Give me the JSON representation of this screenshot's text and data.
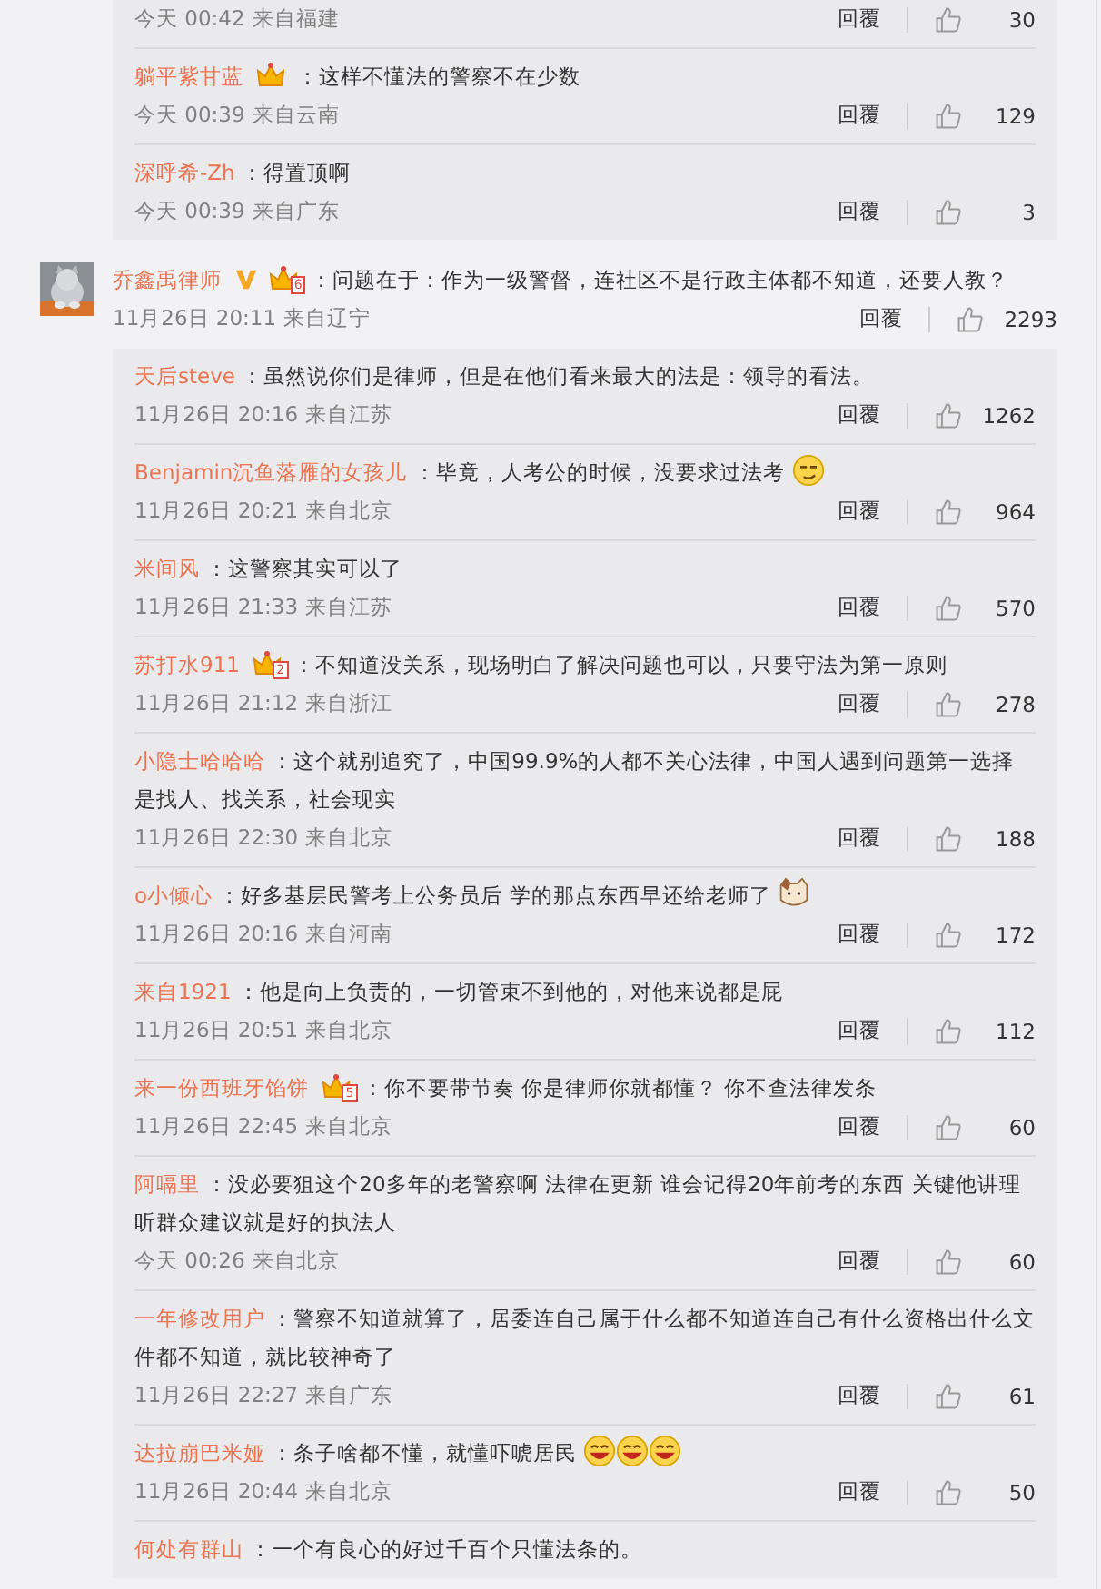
{
  "blocks": [
    {
      "kind": "replies",
      "replies": [
        {
          "time": "今天 00:42",
          "location": "来自福建",
          "reply_label": "回覆",
          "likes": "30"
        },
        {
          "user": "躺平紫甘蓝",
          "badge": {
            "kind": "crown"
          },
          "text": "：这样不懂法的警察不在少数",
          "time": "今天 00:39",
          "location": "来自云南",
          "reply_label": "回覆",
          "likes": "129"
        },
        {
          "user": "深呼希-Zh",
          "text": "：得置顶啊",
          "time": "今天 00:39",
          "location": "来自广东",
          "reply_label": "回覆",
          "likes": "3"
        }
      ]
    },
    {
      "kind": "comment",
      "user": "乔鑫禹律师",
      "verified": true,
      "badge": {
        "kind": "crown",
        "level": "6"
      },
      "text": "：问题在于：作为一级警督，连社区不是行政主体都不知道，还要人教？",
      "time": "11月26日 20:11",
      "location": "来自辽宁",
      "reply_label": "回覆",
      "likes": "2293"
    },
    {
      "kind": "replies",
      "replies": [
        {
          "user": "天后steve",
          "text": "：虽然说你们是律师，但是在他们看来最大的法是：领导的看法。",
          "time": "11月26日 20:16",
          "location": "来自江苏",
          "reply_label": "回覆",
          "likes": "1262"
        },
        {
          "user": "Benjamin沉鱼落雁的女孩儿",
          "text": "：毕竟，人考公的时候，没要求过法考",
          "emojis": [
            {
              "kind": "smirk"
            }
          ],
          "time": "11月26日 20:21",
          "location": "来自北京",
          "reply_label": "回覆",
          "likes": "964"
        },
        {
          "user": "米间风",
          "text": "：这警察其实可以了",
          "time": "11月26日 21:33",
          "location": "来自江苏",
          "reply_label": "回覆",
          "likes": "570"
        },
        {
          "user": "苏打水911",
          "badge": {
            "kind": "crown",
            "level": "2"
          },
          "text": "：不知道没关系，现场明白了解决问题也可以，只要守法为第一原则",
          "time": "11月26日 21:12",
          "location": "来自浙江",
          "reply_label": "回覆",
          "likes": "278"
        },
        {
          "user": "小隐士哈哈哈",
          "text": "：这个就别追究了，中国99.9%的人都不关心法律，中国人遇到问题第一选择是找人、找关系，社会现实",
          "time": "11月26日 22:30",
          "location": "来自北京",
          "reply_label": "回覆",
          "likes": "188"
        },
        {
          "user": "o小倾心",
          "text": "：好多基层民警考上公务员后 学的那点东西早还给老师了",
          "emojis": [
            {
              "kind": "cat"
            }
          ],
          "time": "11月26日 20:16",
          "location": "来自河南",
          "reply_label": "回覆",
          "likes": "172"
        },
        {
          "user": "来自1921",
          "text": "：他是向上负责的，一切管束不到他的，对他来说都是屁",
          "time": "11月26日 20:51",
          "location": "来自北京",
          "reply_label": "回覆",
          "likes": "112"
        },
        {
          "user": "来一份西班牙馅饼",
          "badge": {
            "kind": "crown",
            "level": "5"
          },
          "text": "：你不要带节奏 你是律师你就都懂？ 你不查法律发条",
          "time": "11月26日 22:45",
          "location": "来自北京",
          "reply_label": "回覆",
          "likes": "60"
        },
        {
          "user": "阿嗝里",
          "text": "：没必要狙这个20多年的老警察啊 法律在更新 谁会记得20年前考的东西 关键他讲理听群众建议就是好的执法人",
          "time": "今天 00:26",
          "location": "来自北京",
          "reply_label": "回覆",
          "likes": "60"
        },
        {
          "user": "一年修改用户",
          "text": "：警察不知道就算了，居委连自己属于什么都不知道连自己有什么资格出什么文件都不知道，就比较神奇了",
          "time": "11月26日 22:27",
          "location": "来自广东",
          "reply_label": "回覆",
          "likes": "61"
        },
        {
          "user": "达拉崩巴米娅",
          "text": "：条子啥都不懂，就懂吓唬居民",
          "emojis": [
            {
              "kind": "laugh"
            },
            {
              "kind": "laugh"
            },
            {
              "kind": "laugh"
            }
          ],
          "time": "11月26日 20:44",
          "location": "来自北京",
          "reply_label": "回覆",
          "likes": "50"
        },
        {
          "user": "何处有群山",
          "text": "：一个有良心的好过千百个只懂法条的。"
        }
      ]
    }
  ]
}
